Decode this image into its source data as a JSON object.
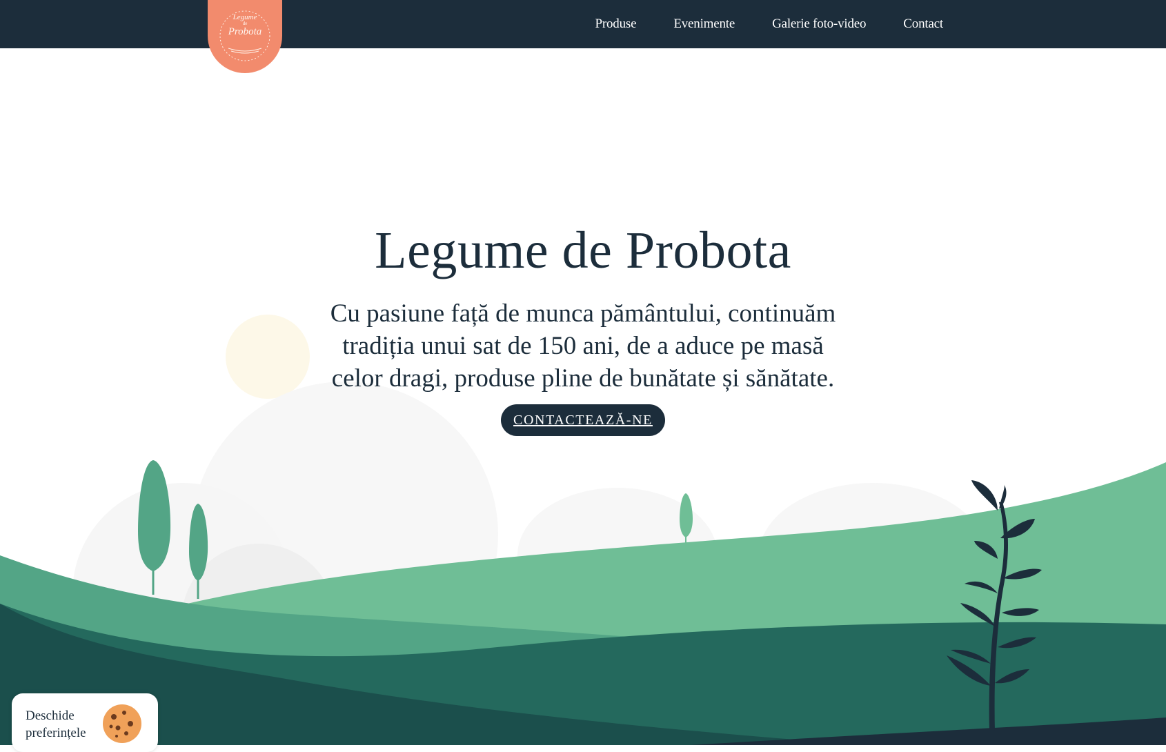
{
  "header": {
    "logo": {
      "line1": "Legume",
      "line2": "de",
      "line3": "Probota"
    },
    "nav": [
      {
        "label": "Produse"
      },
      {
        "label": "Evenimente"
      },
      {
        "label": "Galerie foto-video"
      },
      {
        "label": "Contact"
      }
    ]
  },
  "hero": {
    "title": "Legume de Probota",
    "subtitle": "Cu pasiune față de munca pământului, continuăm tradiția unui sat de 150 ani, de a aduce pe masă celor dragi, produse pline de bunătate și sănătate.",
    "cta_label": "CONTACTEAZĂ-NE"
  },
  "cookie_widget": {
    "label": "Deschide preferințele",
    "icon": "cookie-icon"
  },
  "colors": {
    "navy": "#1c2d3b",
    "logo": "#f28b6d",
    "hill_light": "#6fbe96",
    "hill_mid": "#53a586",
    "hill_dark": "#24695d",
    "hill_deep": "#1b4f4c",
    "sun": "#fdf8e8",
    "cookie": "#f0a159"
  }
}
